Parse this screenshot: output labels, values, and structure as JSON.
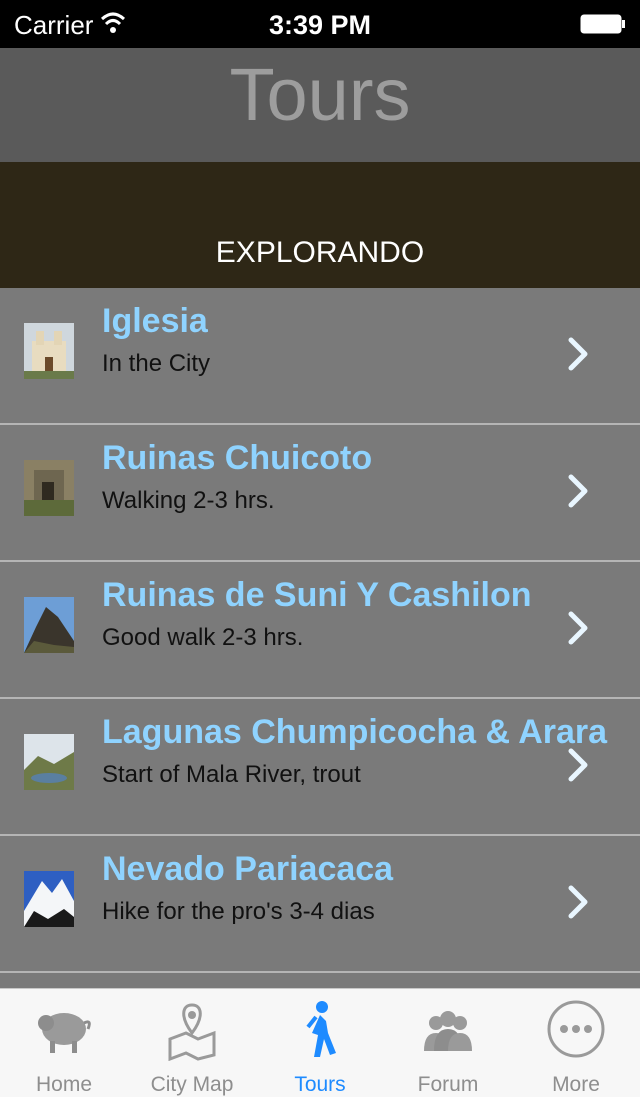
{
  "status_bar": {
    "carrier": "Carrier",
    "time": "3:39 PM"
  },
  "nav": {
    "title": "Tours"
  },
  "banner": {
    "text": "EXPLORANDO"
  },
  "tours": [
    {
      "title": "Iglesia",
      "subtitle": "In the City",
      "icon": "church-thumbnail"
    },
    {
      "title": "Ruinas Chuicoto",
      "subtitle": "Walking 2-3 hrs.",
      "icon": "ruins-thumbnail"
    },
    {
      "title": "Ruinas de Suni Y Cashilon",
      "subtitle": "Good walk 2-3 hrs.",
      "icon": "rock-peak-thumbnail"
    },
    {
      "title": "Lagunas Chumpicocha & Arara",
      "subtitle": "Start of Mala River, trout",
      "icon": "lagoon-thumbnail"
    },
    {
      "title": "Nevado Pariacaca",
      "subtitle": "Hike for the pro's  3-4 dias",
      "icon": "snow-mountain-thumbnail"
    }
  ],
  "tab_bar": {
    "tabs": [
      {
        "label": "Home",
        "icon": "pig-icon",
        "active": false
      },
      {
        "label": "City Map",
        "icon": "map-pin-icon",
        "active": false
      },
      {
        "label": "Tours",
        "icon": "hiker-icon",
        "active": true
      },
      {
        "label": "Forum",
        "icon": "people-icon",
        "active": false
      },
      {
        "label": "More",
        "icon": "more-icon",
        "active": false
      }
    ]
  },
  "colors": {
    "accent": "#1e8bff",
    "row_title": "#8fd3ff",
    "banner": "#2e2716"
  }
}
